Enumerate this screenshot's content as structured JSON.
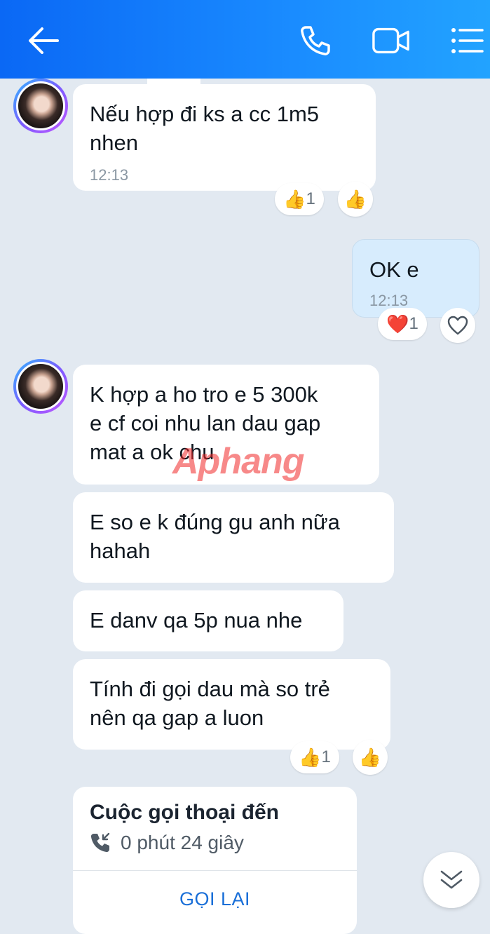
{
  "header": {
    "back_icon": "arrow-left-icon",
    "call_icon": "phone-icon",
    "video_icon": "video-camera-icon",
    "menu_icon": "list-menu-icon"
  },
  "messages": [
    {
      "from": "contact",
      "text_lines": [
        "Nếu hợp đi ks a cc 1m5",
        "nhen"
      ],
      "time": "12:13",
      "reaction": {
        "emoji": "👍",
        "count": "1"
      }
    },
    {
      "from": "me",
      "text_lines": [
        "OK e"
      ],
      "time": "12:13",
      "reaction": {
        "emoji": "❤️",
        "count": "1"
      }
    },
    {
      "from": "contact",
      "text_lines": [
        "K hợp a ho tro e 5 300k",
        "e cf coi nhu lan dau gap",
        "mat a ok chu"
      ]
    },
    {
      "from": "contact",
      "text_lines": [
        "E so e k đúng gu anh nữa",
        "hahah"
      ]
    },
    {
      "from": "contact",
      "text_lines": [
        "E danv qa 5p nua nhe"
      ]
    },
    {
      "from": "contact",
      "text_lines": [
        "Tính đi gọi dau mà so trẻ",
        "nên qa gap a luon"
      ],
      "reaction": {
        "emoji": "👍",
        "count": "1"
      }
    }
  ],
  "call_card": {
    "title": "Cuộc gọi thoại đến",
    "duration": "0 phút 24 giây",
    "callback_label": "GỌI LẠI"
  },
  "watermark": "Aphang",
  "colors": {
    "header_start": "#0a68f5",
    "header_end": "#22a3ff",
    "background": "#e2e9f1",
    "my_bubble": "#d7ecfd",
    "link": "#1a6fd8"
  }
}
